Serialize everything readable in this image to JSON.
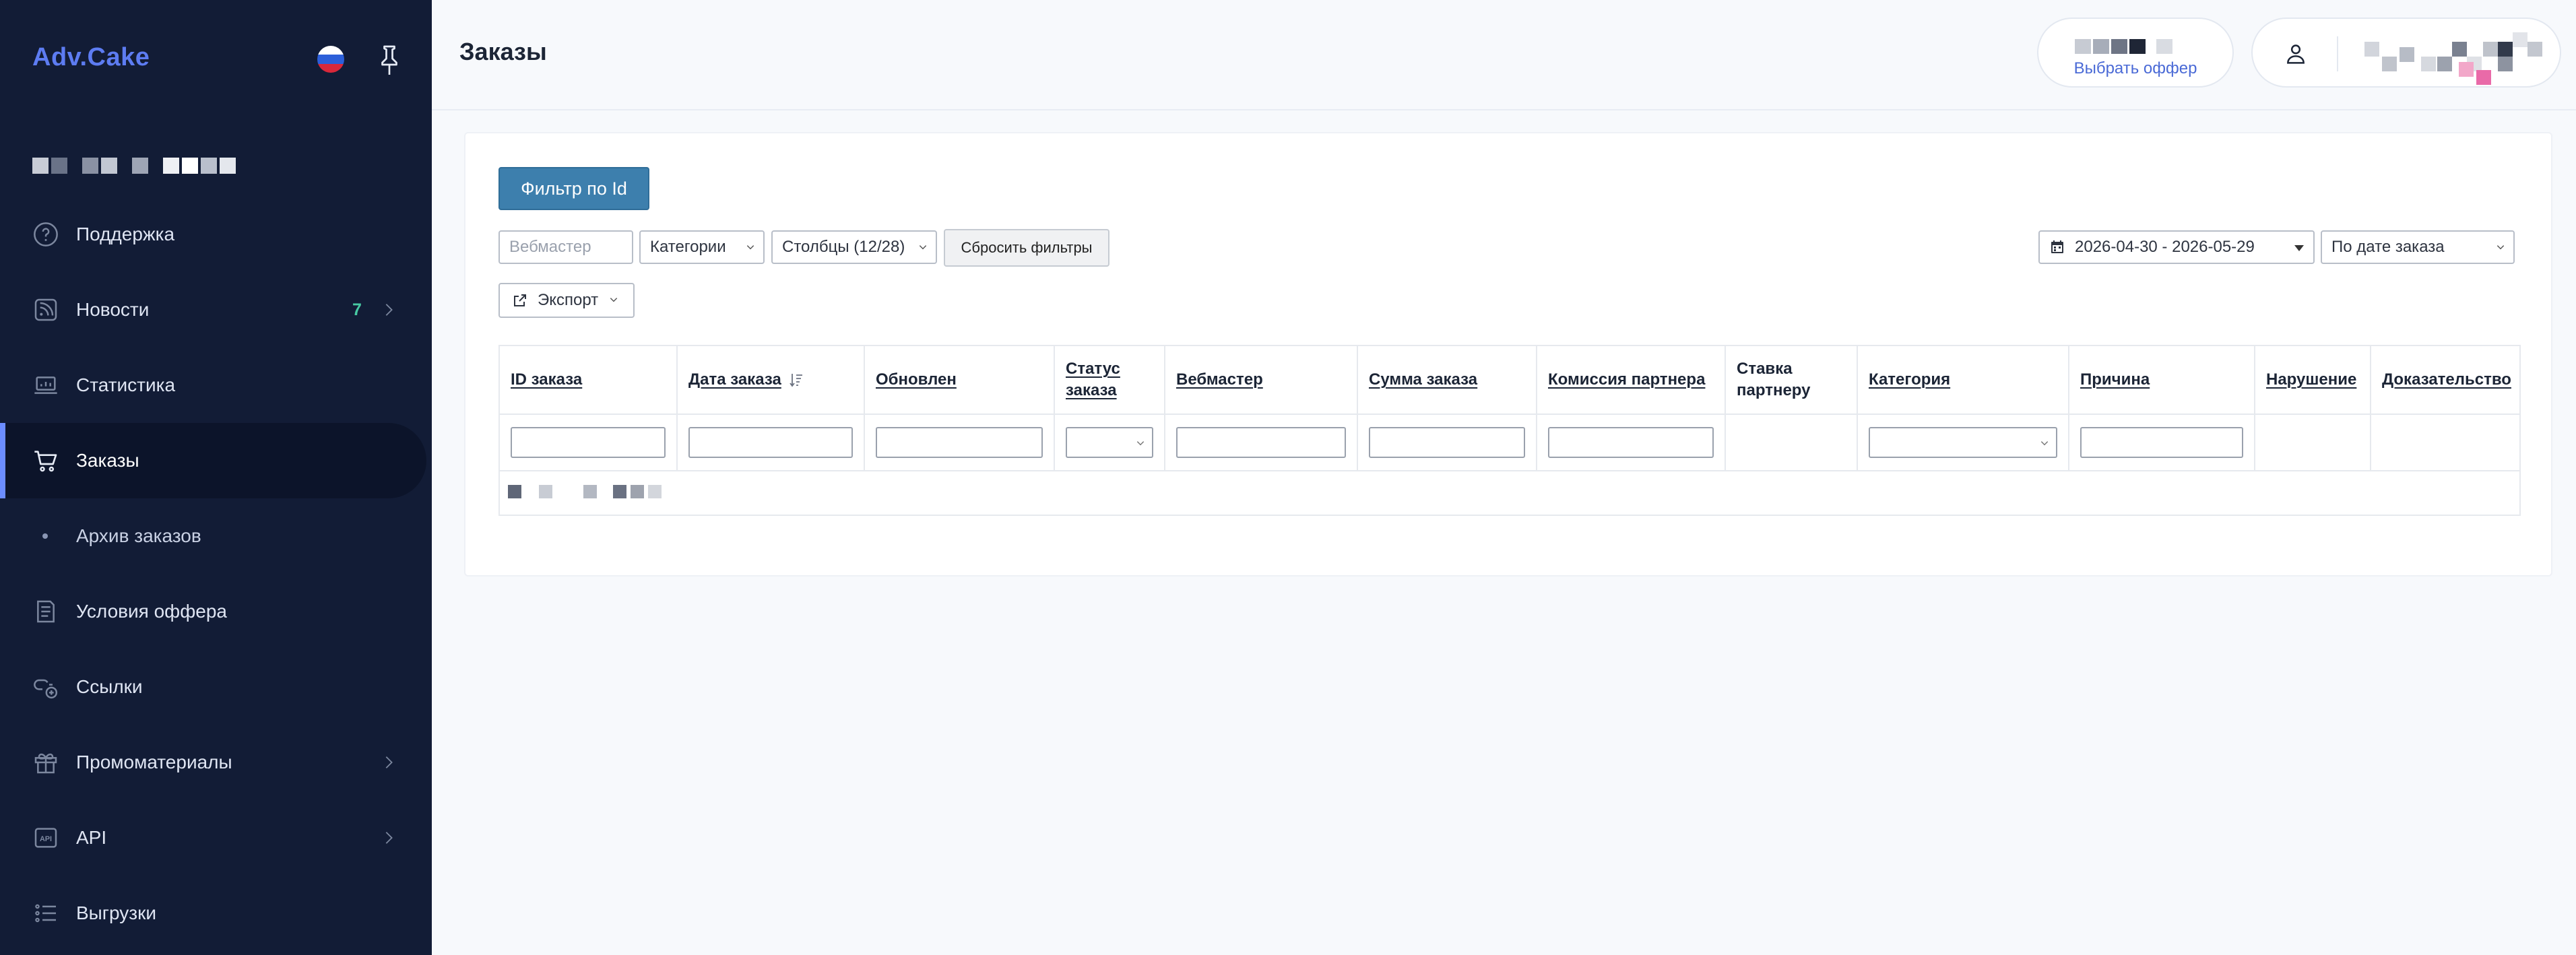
{
  "app": {
    "logo": "Adv.Cake",
    "flag_colors": [
      "#ffffff",
      "#2c5fd9",
      "#d9283a"
    ]
  },
  "sidebar": {
    "items": [
      {
        "label": "Поддержка",
        "icon": "help-circle-icon"
      },
      {
        "label": "Новости",
        "icon": "rss-icon",
        "badge": "7",
        "has_chevron": true
      },
      {
        "label": "Статистика",
        "icon": "laptop-chart-icon"
      },
      {
        "label": "Заказы",
        "icon": "cart-icon",
        "active": true
      },
      {
        "label": "Архив заказов",
        "icon": "dot-icon",
        "sub": true
      },
      {
        "label": "Условия оффера",
        "icon": "document-icon"
      },
      {
        "label": "Ссылки",
        "icon": "link-add-icon"
      },
      {
        "label": "Промоматериалы",
        "icon": "gift-icon",
        "has_chevron": true
      },
      {
        "label": "API",
        "icon": "api-icon",
        "has_chevron": true
      },
      {
        "label": "Выгрузки",
        "icon": "list-icon"
      }
    ],
    "accent_color": "#6c8dff"
  },
  "header": {
    "title": "Заказы",
    "offer_link": "Выбрать оффер"
  },
  "filters": {
    "filter_by_id_label": "Фильтр по Id",
    "webmaster_placeholder": "Вебмастер",
    "categories_label": "Категории",
    "columns_label": "Столбцы (12/28)",
    "reset_label": "Сбросить фильтры",
    "date_range": "2026-04-30 - 2026-05-29",
    "date_type": "По дате заказа",
    "export_label": "Экспорт"
  },
  "table": {
    "columns": [
      {
        "label": "ID заказа",
        "sortable": true
      },
      {
        "label": "Дата заказа",
        "sortable": true,
        "sorted": true
      },
      {
        "label": "Обновлен",
        "sortable": true
      },
      {
        "label": "Статус заказа",
        "sortable": true
      },
      {
        "label": "Вебмастер",
        "sortable": true
      },
      {
        "label": "Сумма заказа",
        "sortable": true
      },
      {
        "label": "Комиссия партнера",
        "sortable": true
      },
      {
        "label": "Ставка партнеру",
        "sortable": false
      },
      {
        "label": "Категория",
        "sortable": true
      },
      {
        "label": "Причина",
        "sortable": true
      },
      {
        "label": "Нарушение",
        "sortable": true
      },
      {
        "label": "Доказательство",
        "sortable": true
      }
    ]
  },
  "colors": {
    "sidebar_bg": "#121c36",
    "primary_button": "#3d7fad",
    "link": "#4a6ad6",
    "badge": "#47c9a3"
  }
}
